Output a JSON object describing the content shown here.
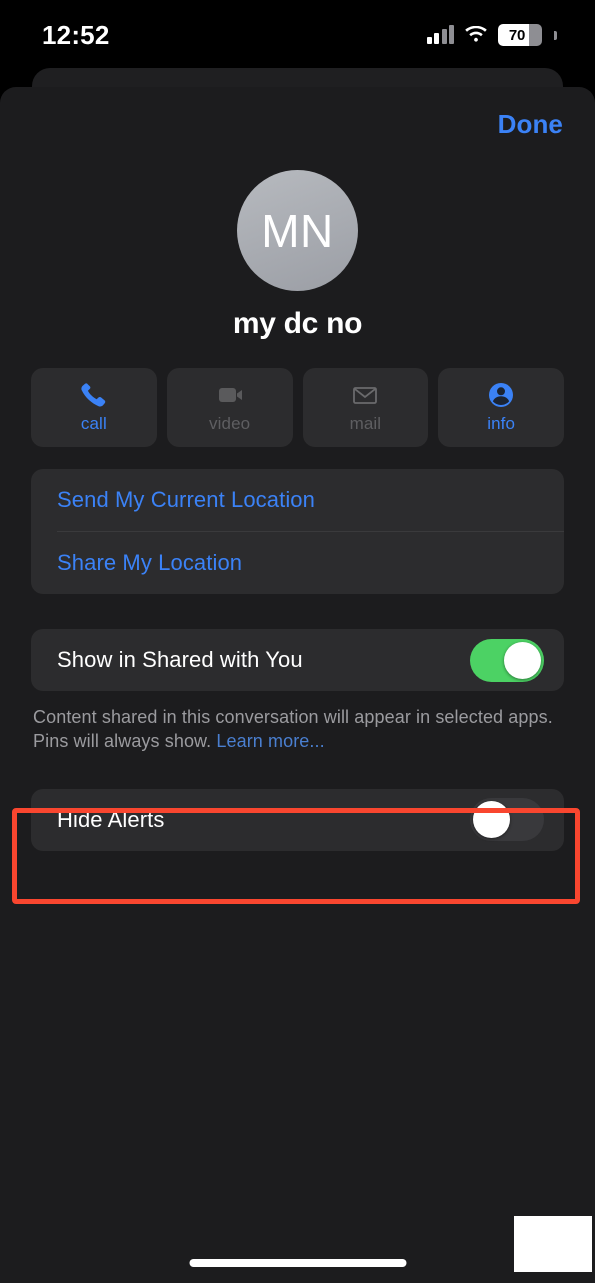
{
  "status_bar": {
    "time": "12:52",
    "cellular_icon": "cellular-bars-icon",
    "wifi_icon": "wifi-icon",
    "battery_level": "70",
    "battery_percent": 70
  },
  "sheet": {
    "done_label": "Done",
    "contact": {
      "initials": "MN",
      "name": "my dc no"
    },
    "actions": [
      {
        "label": "call",
        "icon": "phone-icon",
        "enabled": true
      },
      {
        "label": "video",
        "icon": "video-icon",
        "enabled": false
      },
      {
        "label": "mail",
        "icon": "mail-icon",
        "enabled": false
      },
      {
        "label": "info",
        "icon": "person-circle-icon",
        "enabled": true
      }
    ],
    "location_rows": [
      {
        "label": "Send My Current Location"
      },
      {
        "label": "Share My Location"
      }
    ],
    "shared_with_you": {
      "label": "Show in Shared with You",
      "toggle_state": "on",
      "footer_text": "Content shared in this conversation will appear in selected apps. Pins will always show. ",
      "footer_link": "Learn more..."
    },
    "hide_alerts": {
      "label": "Hide Alerts",
      "toggle_state": "off"
    }
  },
  "annotation": {
    "color": "#f9462f",
    "target": "hide-alerts-row"
  },
  "colors": {
    "accent_blue": "#3b82f6",
    "toggle_on_green": "#4cd264",
    "toggle_off_gray": "#39393c",
    "sheet_background": "#1c1c1e",
    "card_background": "#2c2c2e"
  },
  "home_indicator": "home-indicator"
}
